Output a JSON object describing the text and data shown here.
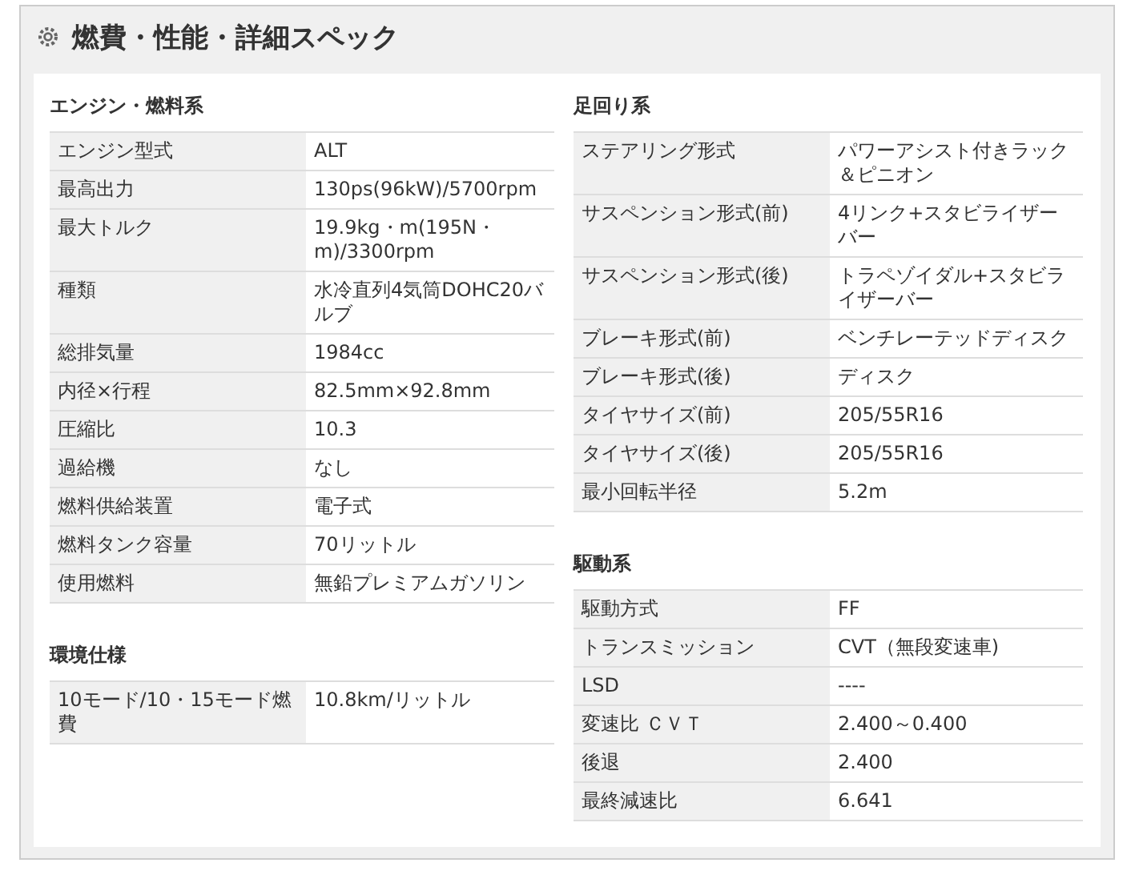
{
  "title": "燃費・性能・詳細スペック",
  "columns": [
    {
      "sections": [
        {
          "heading": "エンジン・燃料系",
          "rows": [
            {
              "label": "エンジン型式",
              "value": "ALT"
            },
            {
              "label": "最高出力",
              "value": "130ps(96kW)/5700rpm"
            },
            {
              "label": "最大トルク",
              "value": "19.9kg・m(195N・m)/3300rpm"
            },
            {
              "label": "種類",
              "value": "水冷直列4気筒DOHC20バルブ"
            },
            {
              "label": "総排気量",
              "value": "1984cc"
            },
            {
              "label": "内径×行程",
              "value": "82.5mm×92.8mm"
            },
            {
              "label": "圧縮比",
              "value": "10.3"
            },
            {
              "label": "過給機",
              "value": "なし"
            },
            {
              "label": "燃料供給装置",
              "value": "電子式"
            },
            {
              "label": "燃料タンク容量",
              "value": "70リットル"
            },
            {
              "label": "使用燃料",
              "value": "無鉛プレミアムガソリン"
            }
          ]
        },
        {
          "heading": "環境仕様",
          "rows": [
            {
              "label": "10モード/10・15モード燃費",
              "value": "10.8km/リットル"
            }
          ]
        }
      ]
    },
    {
      "sections": [
        {
          "heading": "足回り系",
          "rows": [
            {
              "label": "ステアリング形式",
              "value": "パワーアシスト付きラック＆ピニオン"
            },
            {
              "label": "サスペンション形式(前)",
              "value": "4リンク+スタビライザーバー"
            },
            {
              "label": "サスペンション形式(後)",
              "value": "トラペゾイダル+スタビライザーバー"
            },
            {
              "label": "ブレーキ形式(前)",
              "value": "ベンチレーテッドディスク"
            },
            {
              "label": "ブレーキ形式(後)",
              "value": "ディスク"
            },
            {
              "label": "タイヤサイズ(前)",
              "value": "205/55R16"
            },
            {
              "label": "タイヤサイズ(後)",
              "value": "205/55R16"
            },
            {
              "label": "最小回転半径",
              "value": "5.2m"
            }
          ]
        },
        {
          "heading": "駆動系",
          "rows": [
            {
              "label": "駆動方式",
              "value": "FF"
            },
            {
              "label": "トランスミッション",
              "value": "CVT（無段変速車)"
            },
            {
              "label": "LSD",
              "value": "----"
            },
            {
              "label": "変速比 ＣＶＴ",
              "value": "2.400～0.400"
            },
            {
              "label": "後退",
              "value": "2.400"
            },
            {
              "label": "最終減速比",
              "value": "6.641"
            }
          ]
        }
      ]
    }
  ]
}
